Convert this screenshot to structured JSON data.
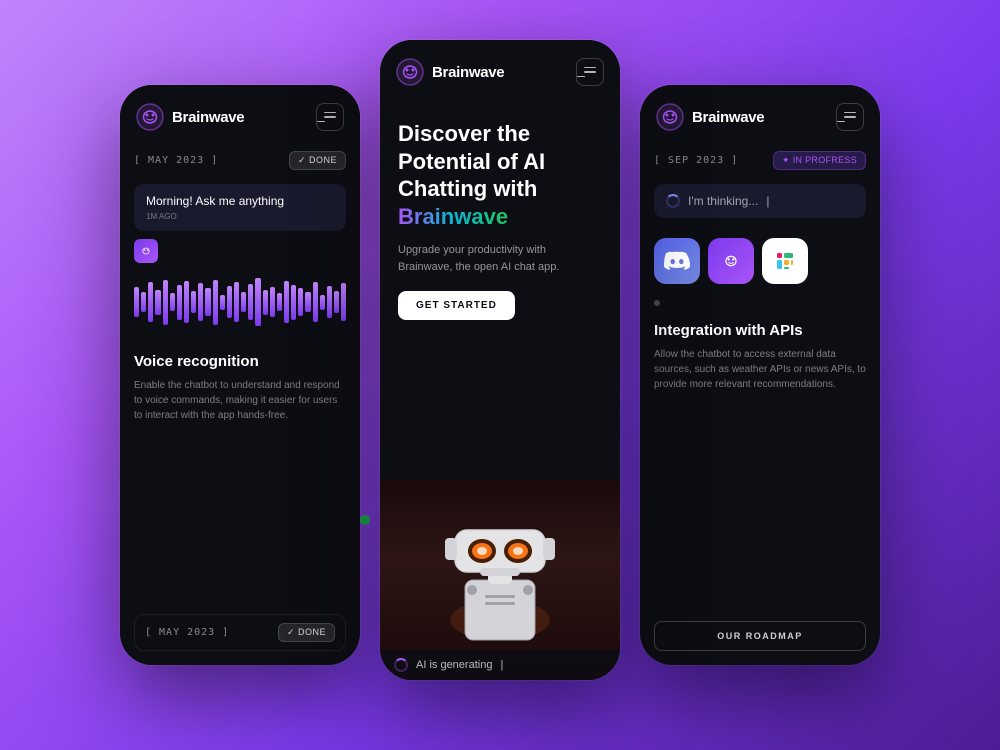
{
  "app": {
    "brand_name": "Brainwave",
    "menu_label": "menu"
  },
  "phone1": {
    "date": "[ MAY 2023 ]",
    "status": "✓ DONE",
    "chat_message": "Morning! Ask me anything",
    "chat_time": "1M AGO",
    "voice_title": "Voice recognition",
    "voice_desc": "Enable the chatbot to understand and respond to voice commands, making it easier for users to interact with the app hands-free.",
    "bottom_date": "[ MAY 2023 ]",
    "bottom_status": "✓ DONE"
  },
  "phone2": {
    "hero_title_line1": "Discover the",
    "hero_title_line2": "Potential of AI",
    "hero_title_line3": "Chatting with",
    "hero_title_highlight": "Brainwave",
    "subtitle": "Upgrade your productivity with Brainwave, the open AI chat app.",
    "cta_button": "GET STARTED",
    "ai_generating": "AI is generating"
  },
  "phone3": {
    "date": "[ SEP 2023 ]",
    "status": "✦ IN PROFRESS",
    "thinking_text": "I'm thinking...",
    "integration_title": "Integration with APIs",
    "integration_desc": "Allow the chatbot to access external data sources, such as weather APIs or news APIs, to provide more relevant recommendations.",
    "roadmap_button": "OUR ROADMAP"
  }
}
